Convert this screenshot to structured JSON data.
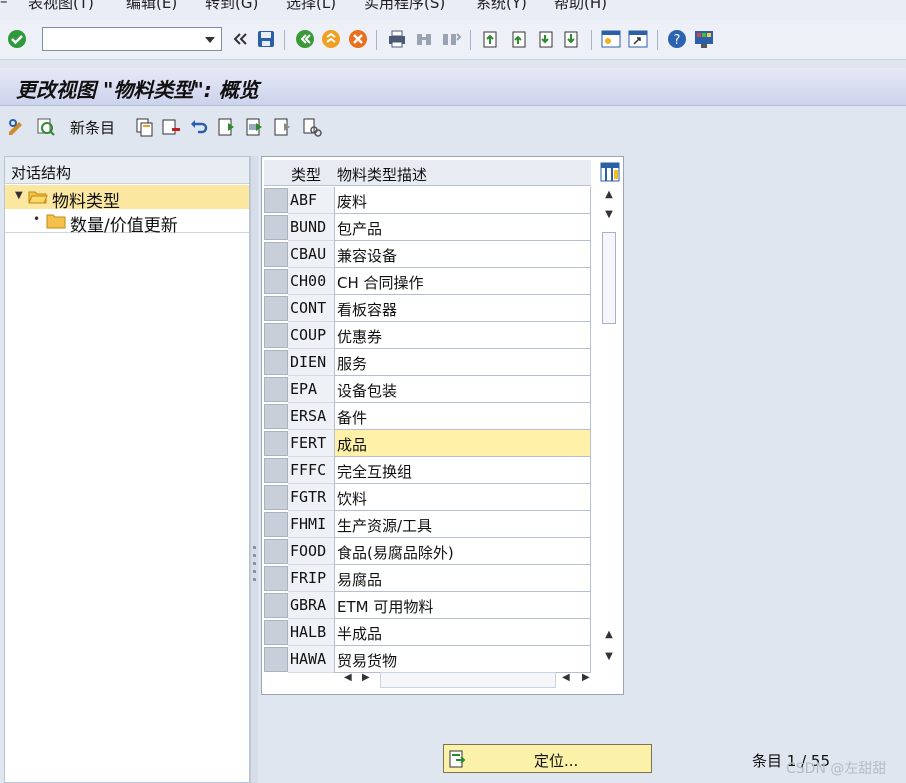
{
  "menu": {
    "items": [
      "表视图(T)",
      "编辑(E)",
      "转到(G)",
      "选择(L)",
      "实用程序(S)",
      "系统(Y)",
      "帮助(H)"
    ]
  },
  "toolbar": {
    "command_value": "",
    "icons": [
      "check-icon",
      "dropdown-icon",
      "double-left-arrow-icon",
      "save-icon",
      "back-icon",
      "exit-icon",
      "cancel-icon",
      "print-icon",
      "find-icon",
      "find-next-icon",
      "first-page-icon",
      "previous-page-icon",
      "next-page-icon",
      "last-page-icon",
      "create-session-icon",
      "shortcut-icon",
      "help-icon",
      "customize-layout-icon"
    ]
  },
  "title": "更改视图 \"物料类型\": 概览",
  "app_toolbar": {
    "new_entry_label": "新条目"
  },
  "tree": {
    "header": "对话结构",
    "nodes": [
      {
        "label": "物料类型",
        "expanded": true,
        "selected": true
      },
      {
        "label": "数量/价值更新",
        "expanded": false,
        "selected": false
      }
    ]
  },
  "table": {
    "columns": [
      "类型",
      "物料类型描述"
    ],
    "rows": [
      {
        "code": "ABF",
        "desc": "废料"
      },
      {
        "code": "BUND",
        "desc": "包产品"
      },
      {
        "code": "CBAU",
        "desc": "兼容设备"
      },
      {
        "code": "CH00",
        "desc": "CH 合同操作"
      },
      {
        "code": "CONT",
        "desc": "看板容器"
      },
      {
        "code": "COUP",
        "desc": "优惠券"
      },
      {
        "code": "DIEN",
        "desc": "服务"
      },
      {
        "code": "EPA",
        "desc": "设备包装"
      },
      {
        "code": "ERSA",
        "desc": "备件"
      },
      {
        "code": "FERT",
        "desc": "成品"
      },
      {
        "code": "FFFC",
        "desc": "完全互换组"
      },
      {
        "code": "FGTR",
        "desc": "饮料"
      },
      {
        "code": "FHMI",
        "desc": "生产资源/工具"
      },
      {
        "code": "FOOD",
        "desc": "食品(易腐品除外)"
      },
      {
        "code": "FRIP",
        "desc": "易腐品"
      },
      {
        "code": "GBRA",
        "desc": "ETM 可用物料"
      },
      {
        "code": "HALB",
        "desc": "半成品"
      },
      {
        "code": "HAWA",
        "desc": "贸易货物"
      }
    ],
    "active_row_index": 9
  },
  "footer": {
    "position_button": "定位...",
    "entry_info": "条目 1 / 55",
    "watermark": "CSDN @左甜甜"
  }
}
